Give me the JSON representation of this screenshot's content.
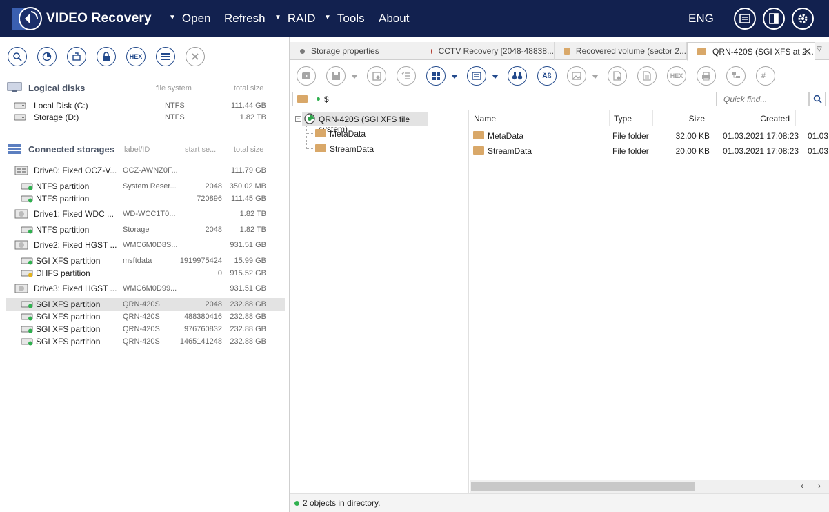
{
  "app": {
    "title": "VIDEO Recovery"
  },
  "menu": [
    {
      "label": "Open",
      "has_dropdown": true
    },
    {
      "label": "Refresh",
      "has_dropdown": false
    },
    {
      "label": "RAID",
      "has_dropdown": true
    },
    {
      "label": "Tools",
      "has_dropdown": true
    },
    {
      "label": "About",
      "has_dropdown": false
    }
  ],
  "lang": "ENG",
  "left_toolbar": {
    "hex_label": "HEX"
  },
  "logical_disks": {
    "title": "Logical disks",
    "col_fs": "file system",
    "col_size": "total size",
    "items": [
      {
        "name": "Local Disk (C:)",
        "fs": "NTFS",
        "size": "111.44 GB"
      },
      {
        "name": "Storage (D:)",
        "fs": "NTFS",
        "size": "1.82 TB"
      }
    ]
  },
  "connected_storages": {
    "title": "Connected storages",
    "col_label": "label/ID",
    "col_start": "start se...",
    "col_size": "total size",
    "items": [
      {
        "kind": "drive",
        "name": "Drive0: Fixed OCZ-V...",
        "label": "OCZ-AWNZ0F...",
        "start": "",
        "size": "111.79 GB"
      },
      {
        "kind": "part",
        "name": "NTFS partition",
        "label": "System Reser...",
        "start": "2048",
        "size": "350.02 MB"
      },
      {
        "kind": "part",
        "name": "NTFS partition",
        "label": "",
        "start": "720896",
        "size": "111.45 GB"
      },
      {
        "kind": "drive",
        "name": "Drive1: Fixed WDC ...",
        "label": "WD-WCC1T0...",
        "start": "",
        "size": "1.82 TB"
      },
      {
        "kind": "part",
        "name": "NTFS partition",
        "label": "Storage",
        "start": "2048",
        "size": "1.82 TB"
      },
      {
        "kind": "drive",
        "name": "Drive2: Fixed HGST ...",
        "label": "WMC6M0D8S...",
        "start": "",
        "size": "931.51 GB"
      },
      {
        "kind": "part",
        "name": "SGI XFS partition",
        "label": "msftdata",
        "start": "1919975424",
        "size": "15.99 GB"
      },
      {
        "kind": "part-yellow",
        "name": "DHFS partition",
        "label": "",
        "start": "0",
        "size": "915.52 GB"
      },
      {
        "kind": "drive",
        "name": "Drive3: Fixed HGST ...",
        "label": "WMC6M0D99...",
        "start": "",
        "size": "931.51 GB"
      },
      {
        "kind": "part",
        "name": "SGI XFS partition",
        "label": "QRN-420S",
        "start": "2048",
        "size": "232.88 GB",
        "selected": true
      },
      {
        "kind": "part",
        "name": "SGI XFS partition",
        "label": "QRN-420S",
        "start": "488380416",
        "size": "232.88 GB"
      },
      {
        "kind": "part",
        "name": "SGI XFS partition",
        "label": "QRN-420S",
        "start": "976760832",
        "size": "232.88 GB"
      },
      {
        "kind": "part",
        "name": "SGI XFS partition",
        "label": "QRN-420S",
        "start": "1465141248",
        "size": "232.88 GB"
      }
    ]
  },
  "tabs": [
    {
      "label": "Storage properties",
      "dot": "#7a7a7a"
    },
    {
      "label": "CCTV Recovery [2048-48838...",
      "dot": "#b23a2e"
    },
    {
      "label": "Recovered volume (sector 2...",
      "folder": true
    },
    {
      "label": "QRN-420S (SGI XFS at 2...",
      "folder": true,
      "active": true
    }
  ],
  "right_toolbar": {
    "hex_label": "HEX",
    "abc_label": "Äß",
    "hash_label": "#_"
  },
  "path": {
    "text": "$"
  },
  "quick_find": {
    "placeholder": "Quick find..."
  },
  "tree": {
    "root": "QRN-420S (SGI XFS file system)",
    "children": [
      "MetaData",
      "StreamData"
    ]
  },
  "file_list": {
    "columns": [
      "Name",
      "Type",
      "Size",
      "Created"
    ],
    "rows": [
      {
        "name": "MetaData",
        "type": "File folder",
        "size": "32.00 KB",
        "created": "01.03.2021 17:08:23",
        "extra": "01.03"
      },
      {
        "name": "StreamData",
        "type": "File folder",
        "size": "20.00 KB",
        "created": "01.03.2021 17:08:23",
        "extra": "01.03"
      }
    ]
  },
  "status": {
    "text": "2 objects in directory."
  },
  "colors": {
    "header_bg": "#12214f",
    "accent": "#234a8c",
    "status_dot": "#2fb04f",
    "folder": "#d9a869"
  }
}
